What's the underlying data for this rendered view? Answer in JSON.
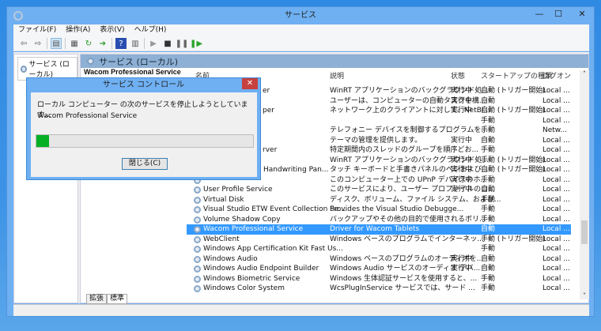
{
  "window": {
    "title": "サービス",
    "min": "—",
    "max": "☐",
    "close": "✕"
  },
  "menu": [
    "ファイル(F)",
    "操作(A)",
    "表示(V)",
    "ヘルプ(H)"
  ],
  "left": {
    "tree_item": "サービス (ローカル)"
  },
  "right": {
    "header": "サービス (ローカル)",
    "selected_service": "Wacom Professional Service"
  },
  "columns": {
    "name": "名前",
    "desc": "説明",
    "status": "状態",
    "startup": "スタートアップの種類",
    "logon": "ログオン"
  },
  "rows": [
    {
      "name": "er",
      "clip": 1,
      "desc": "WinRT アプリケーションのバックグラウンド処...",
      "status": "実行中",
      "startup": "自動 (トリガー開始)",
      "logon": "Local ..."
    },
    {
      "name": "",
      "clip": 1,
      "desc": "ユーザーは、コンピューターの自動タスクを構...",
      "status": "実行中",
      "startup": "自動",
      "logon": "Local ..."
    },
    {
      "name": "per",
      "clip": 1,
      "desc": "ネットワーク上のクライアントに対して、NetBI...",
      "status": "実行中",
      "startup": "自動 (トリガー開始)",
      "logon": "Local ..."
    },
    {
      "name": "",
      "clip": 1,
      "desc": "",
      "status": "",
      "startup": "手動",
      "logon": "Local ..."
    },
    {
      "name": "",
      "clip": 1,
      "desc": "テレフォニー デバイスを制御するプログラムを...",
      "status": "",
      "startup": "手動",
      "logon": "Netw..."
    },
    {
      "name": "",
      "clip": 1,
      "desc": "テーマの管理を提供します。",
      "status": "実行中",
      "startup": "自動",
      "logon": "Local ..."
    },
    {
      "name": "rver",
      "clip": 1,
      "desc": "特定期間内のスレッドのグループを順序どお...",
      "status": "",
      "startup": "手動",
      "logon": "Local ..."
    },
    {
      "name": "",
      "clip": 1,
      "desc": "WinRT アプリケーションのバックグラウンド処...",
      "status": "実行中",
      "startup": "手動 (トリガー開始)",
      "logon": "Local ..."
    },
    {
      "name": " Handwriting Pan...",
      "clip": 1,
      "desc": "タッチ キーボードと手書きパネルのペンおよび...",
      "status": "実行中",
      "startup": "自動 (トリガー開始)",
      "logon": "Local ..."
    },
    {
      "name": "",
      "clip": 1,
      "desc": "このコンピューター上での UPnP デバイスのホ...",
      "status": "実行中",
      "startup": "手動",
      "logon": "Local ..."
    },
    {
      "name": "User Profile Service",
      "desc": "このサービスにより、ユーザー プロファイルのロ...",
      "status": "実行中",
      "startup": "自動",
      "logon": "Local ..."
    },
    {
      "name": "Virtual Disk",
      "desc": "ディスク、ボリューム、ファイル システム、および...",
      "status": "",
      "startup": "手動",
      "logon": "Local ..."
    },
    {
      "name": "Visual Studio ETW Event Collection Se...",
      "desc": "Provides the Visual Studio Debugge...",
      "status": "",
      "startup": "手動",
      "logon": "Local ..."
    },
    {
      "name": "Volume Shadow Copy",
      "desc": "バックアップやその他の目的で使用されるボリ...",
      "status": "",
      "startup": "手動",
      "logon": "Local ..."
    },
    {
      "name": "Wacom Professional Service",
      "desc": "Driver for Wacom Tablets",
      "status": "",
      "startup": "自動",
      "logon": "Local ...",
      "selected": true
    },
    {
      "name": "WebClient",
      "desc": "Windows ベースのプログラムでインターネッ...",
      "status": "",
      "startup": "手動 (トリガー開始)",
      "logon": "Local ..."
    },
    {
      "name": "Windows App Certification Kit Fast Us...",
      "desc": "",
      "status": "",
      "startup": "手動",
      "logon": "Local ..."
    },
    {
      "name": "Windows Audio",
      "desc": "Windows ベースのプログラムのオーディオを...",
      "status": "実行中",
      "startup": "自動",
      "logon": "Local ..."
    },
    {
      "name": "Windows Audio Endpoint Builder",
      "desc": "Windows Audio サービスのオーディオ デバ...",
      "status": "実行中",
      "startup": "自動",
      "logon": "Local ..."
    },
    {
      "name": "Windows Biometric Service",
      "desc": "Windows 生体認証サービスを使用すると、...",
      "status": "",
      "startup": "手動",
      "logon": "Local ..."
    },
    {
      "name": "Windows Color System",
      "desc": "WcsPlugInService サービスでは、サード ...",
      "status": "",
      "startup": "手動",
      "logon": "Local ..."
    }
  ],
  "tabs": [
    "拡張",
    "標準"
  ],
  "dialog": {
    "title": "サービス コントロール",
    "message": "ローカル コンピューター の次のサービスを停止しようとしています...",
    "service": "Wacom Professional Service",
    "progress_percent": 6,
    "close_button": "閉じる(C)",
    "close_icon": "✕"
  },
  "colors": {
    "selection": "#3399ff",
    "progress": "#06b025"
  }
}
